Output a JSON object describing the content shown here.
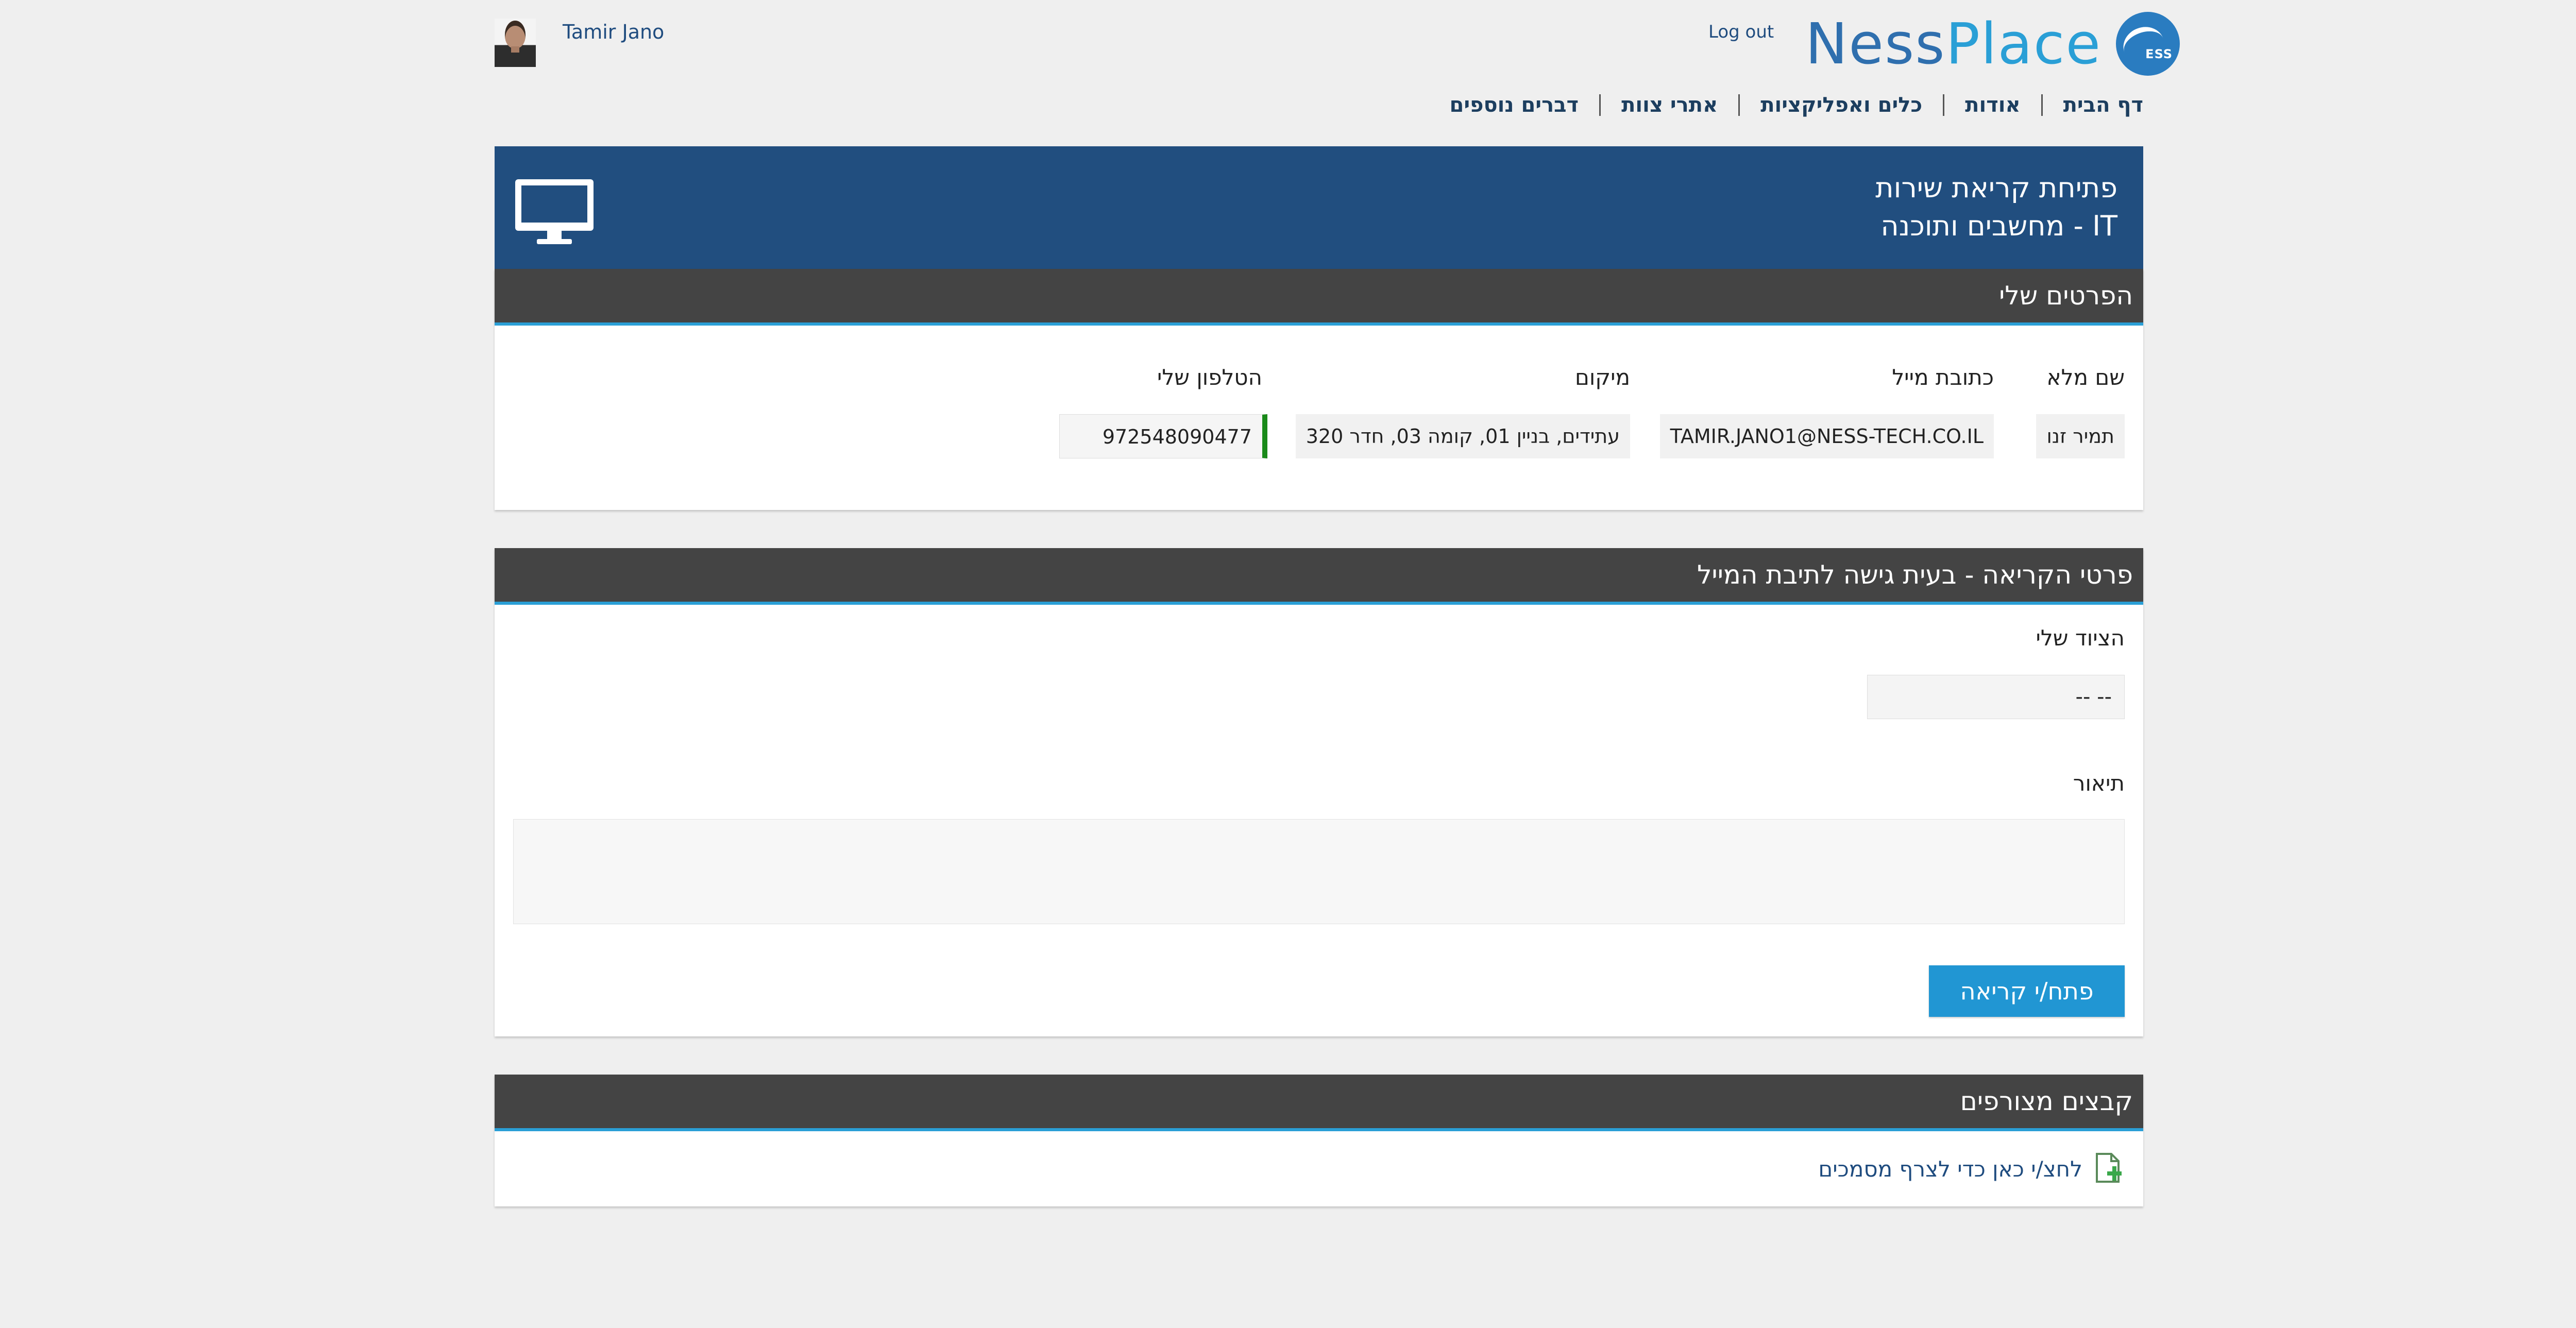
{
  "header": {
    "user_name": "Tamir Jano",
    "logout_label": "Log out",
    "logo_ness": "Ness",
    "logo_place": "Place",
    "logo_badge": "ESS"
  },
  "nav": {
    "items": [
      {
        "label": "דף הבית"
      },
      {
        "label": "אודות"
      },
      {
        "label": "כלים ואפליקציות"
      },
      {
        "label": "אתרי צוות"
      },
      {
        "label": "דברים נוספים"
      }
    ]
  },
  "banner": {
    "title": "פתיחת קריאת שירות",
    "subtitle": "IT - מחשבים ותוכנה",
    "icon": "monitor-icon"
  },
  "my_details": {
    "heading": "הפרטים שלי",
    "full_name_label": "שם מלא",
    "full_name_value": "תמיר זנו",
    "email_label": "כתובת מייל",
    "email_value": "TAMIR.JANO1@NESS-TECH.CO.IL",
    "location_label": "מיקום",
    "location_value": "עתידים, בניין 01, קומה 03, חדר 320",
    "phone_label": "הטלפון שלי",
    "phone_value": "972548090477"
  },
  "call_details": {
    "heading": "פרטי הקריאה - בעית גישה לתיבת המייל",
    "equipment_label": "הציוד שלי",
    "equipment_value": "-- --",
    "description_label": "תיאור",
    "description_value": "",
    "submit_label": "פתח/י קריאה"
  },
  "attachments": {
    "heading": "קבצים מצורפים",
    "link_label": "לחצ/י כאן כדי לצרף מסמכים",
    "icon": "add-file-icon"
  },
  "colors": {
    "banner": "#214e7f",
    "section_header": "#444444",
    "accent": "#2a9fd6",
    "button": "#2196d3",
    "valid_bar": "#1a8a1a",
    "required_bar": "#e01010"
  }
}
